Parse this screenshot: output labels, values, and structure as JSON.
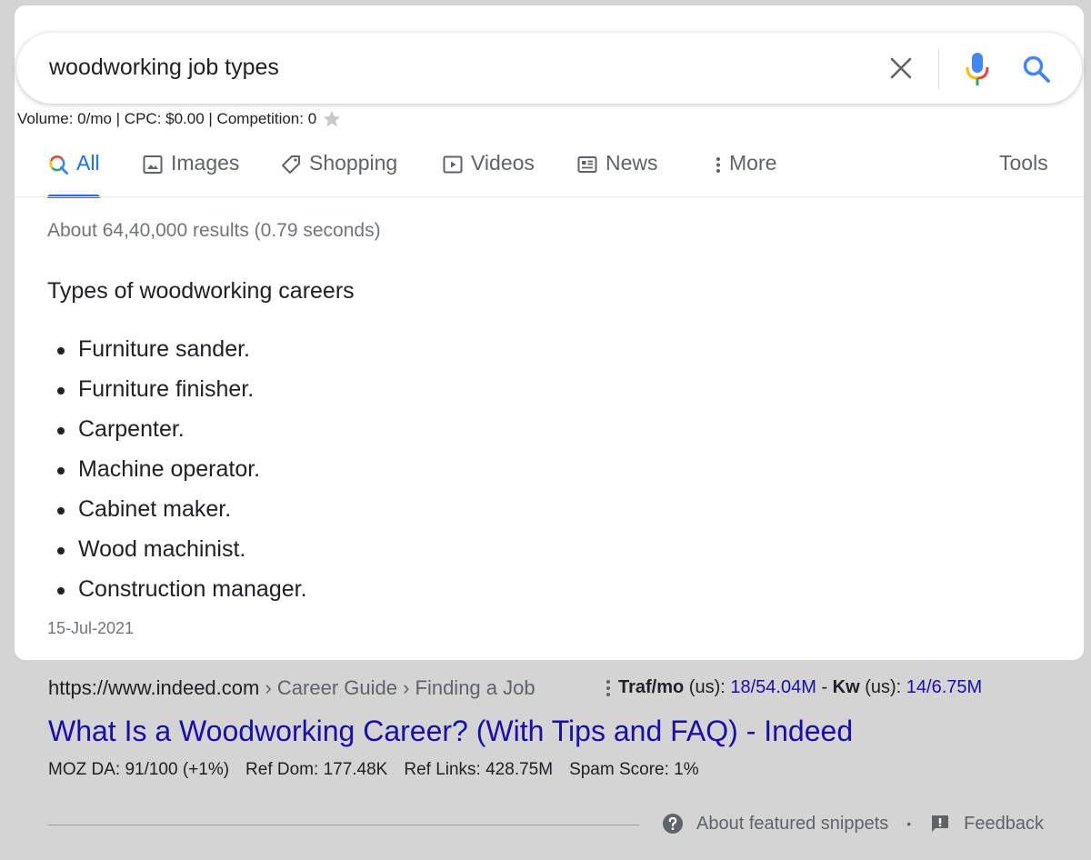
{
  "search": {
    "query": "woodworking job types"
  },
  "keyword_stats": {
    "text": "Volume: 0/mo | CPC: $0.00 | Competition: 0"
  },
  "tabs": [
    {
      "label": "All",
      "icon": "google-search-icon",
      "active": true
    },
    {
      "label": "Images",
      "icon": "image-icon"
    },
    {
      "label": "Shopping",
      "icon": "tag-icon"
    },
    {
      "label": "Videos",
      "icon": "play-icon"
    },
    {
      "label": "News",
      "icon": "newspaper-icon"
    },
    {
      "label": "More",
      "icon": "kebab-icon"
    },
    {
      "label": "Tools"
    }
  ],
  "results_count": "About 64,40,000 results (0.79 seconds)",
  "snippet": {
    "heading": "Types of woodworking careers",
    "items": [
      "Furniture sander.",
      "Furniture finisher.",
      "Carpenter.",
      "Machine operator.",
      "Cabinet maker.",
      "Wood machinist.",
      "Construction manager."
    ],
    "date": "15-Jul-2021"
  },
  "result": {
    "url_domain": "https://www.indeed.com",
    "url_crumbs": " › Career Guide › Finding a Job",
    "traffic": {
      "traf_label": "Traf/mo",
      "region1": " (us): ",
      "traf_value": "18/54.04M",
      "sep": " - ",
      "kw_label": "Kw",
      "region2": " (us): ",
      "kw_value": "14/6.75M"
    },
    "title": "What Is a Woodworking Career? (With Tips and FAQ) - Indeed",
    "moz": {
      "da": "MOZ DA: 91/100 (+1%)",
      "ref_dom": "Ref Dom: 177.48K",
      "ref_links": "Ref Links: 428.75M",
      "spam": "Spam Score: 1%"
    }
  },
  "footer": {
    "about": "About featured snippets",
    "separator": "•",
    "feedback": "Feedback"
  },
  "colors": {
    "link": "#1a0dab",
    "accent": "#1a73e8",
    "muted": "#70757a"
  }
}
